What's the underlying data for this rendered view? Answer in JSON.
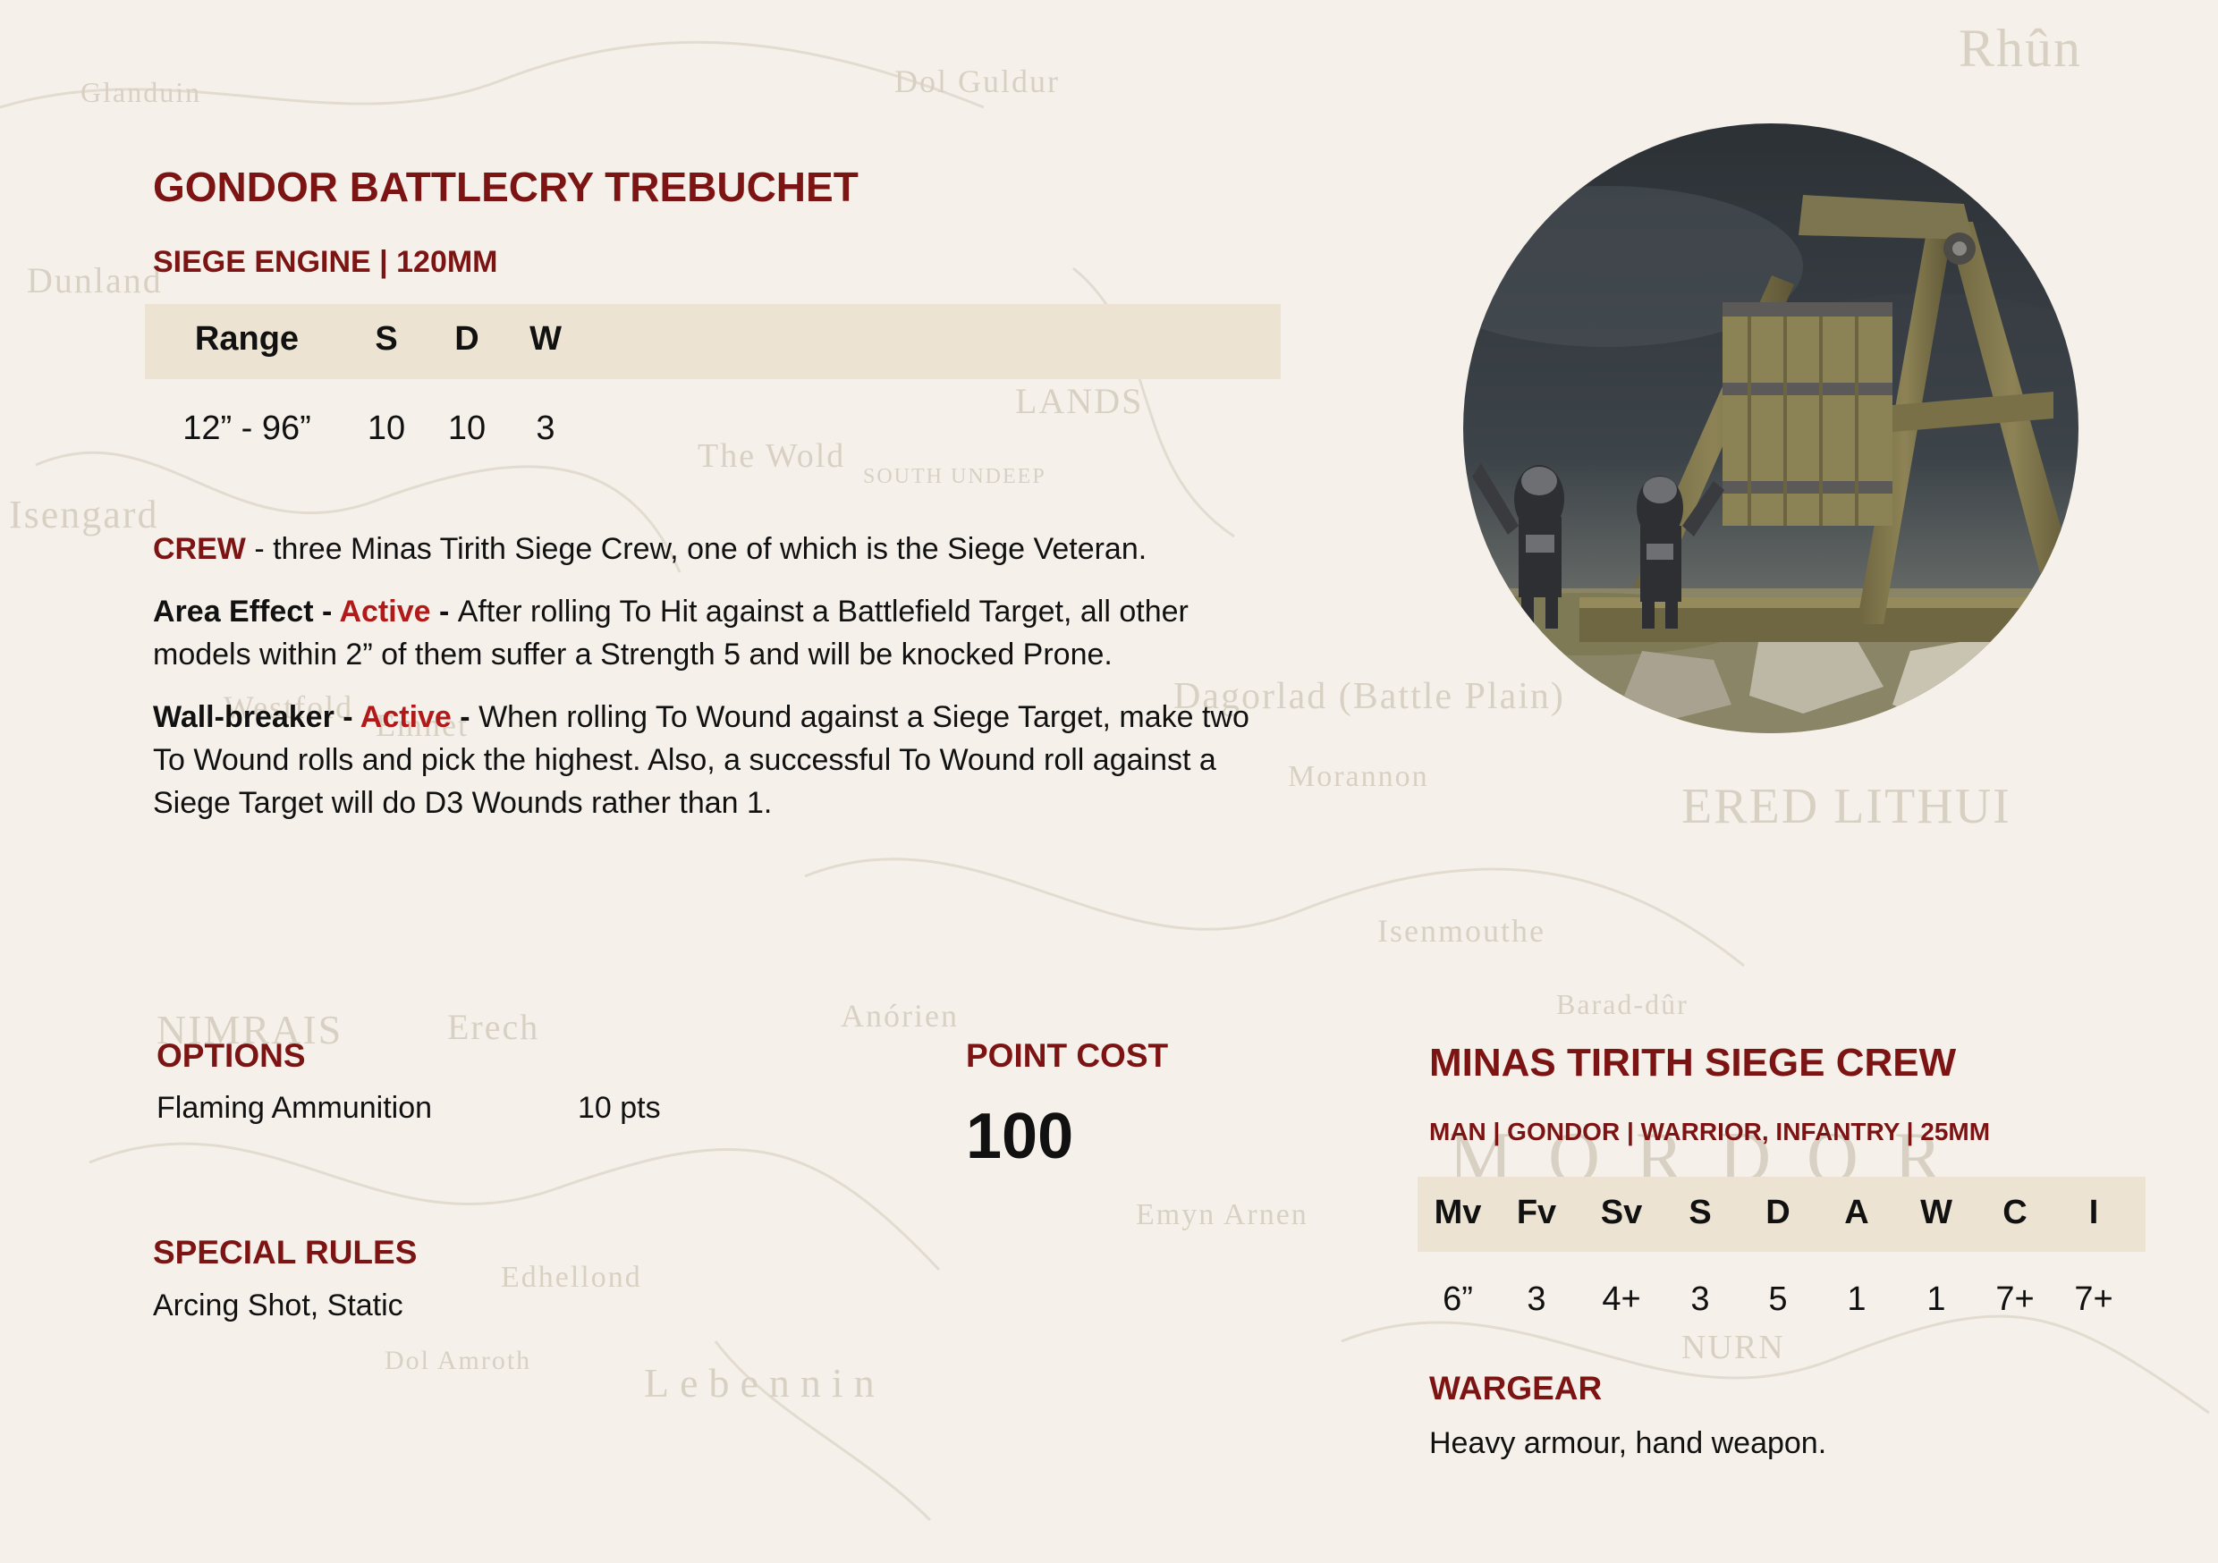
{
  "background_map": {
    "labels": [
      "Rhûn",
      "LANDS",
      "The Wold",
      "SOUTH UNDEEP",
      "Isengard",
      "Dagorlad (Battle Plain)",
      "ERED LITHUI",
      "Morannon",
      "NIMRAIS",
      "Erech",
      "Anórien",
      "Isenmouthe",
      "Barad-dûr",
      "MORDOR",
      "Emyn Arnen",
      "Lebennin",
      "Edhellond",
      "Dol Amroth",
      "NURN",
      "Dunland",
      "Glanduin",
      "Dol Guldur",
      "Emnet",
      "Westfold"
    ]
  },
  "colors": {
    "heading": "#7d1414",
    "active": "#b21a1a",
    "band": "#ede3d2",
    "paper": "#f5f1ea"
  },
  "main": {
    "title": "GONDOR BATTLECRY TREBUCHET",
    "subtitle": "SIEGE ENGINE | 120MM",
    "stats": {
      "headers": [
        "Range",
        "S",
        "D",
        "W"
      ],
      "values": [
        "12” - 96”",
        "10",
        "10",
        "3"
      ]
    },
    "crew": {
      "label": "CREW",
      "text": " - three Minas Tirith Siege Crew, one of which is the Siege Veteran."
    },
    "rules": [
      {
        "name": "Area Effect - ",
        "tag": "Active",
        "sep": " - ",
        "text": "After rolling To Hit against a Battlefield Target, all other models within 2” of them suffer a Strength 5 and will be knocked Prone."
      },
      {
        "name": "Wall-breaker - ",
        "tag": "Active",
        "sep": " - ",
        "text": "When rolling To Wound against a Siege Target, make two To Wound rolls and pick the highest. Also, a successful To Wound roll against a Siege Target will do D3 Wounds rather than 1."
      }
    ]
  },
  "options": {
    "heading": "OPTIONS",
    "items": [
      {
        "name": "Flaming Ammunition",
        "cost": "10 pts"
      }
    ]
  },
  "points": {
    "heading": "POINT COST",
    "value": "100"
  },
  "special_rules": {
    "heading": "SPECIAL RULES",
    "text": "Arcing Shot, Static"
  },
  "crew_profile": {
    "title": "MINAS TIRITH SIEGE CREW",
    "subtitle": "MAN | GONDOR | WARRIOR, INFANTRY | 25MM",
    "stats": {
      "headers": [
        "Mv",
        "Fv",
        "Sv",
        "S",
        "D",
        "A",
        "W",
        "C",
        "I"
      ],
      "values": [
        "6”",
        "3",
        "4+",
        "3",
        "5",
        "1",
        "1",
        "7+",
        "7+"
      ]
    },
    "wargear": {
      "heading": "WARGEAR",
      "text": "Heavy armour, hand weapon."
    }
  }
}
